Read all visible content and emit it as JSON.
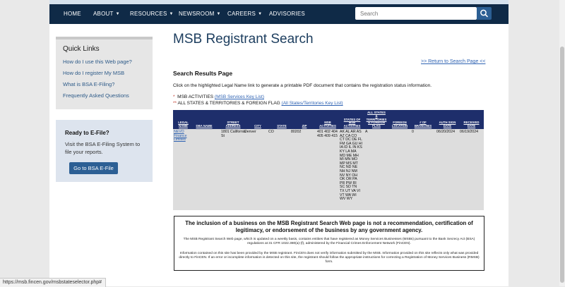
{
  "nav": {
    "items": [
      {
        "label": "HOME",
        "dropdown": false
      },
      {
        "label": "ABOUT",
        "dropdown": true
      },
      {
        "label": "RESOURCES",
        "dropdown": true
      },
      {
        "label": "NEWSROOM",
        "dropdown": true
      },
      {
        "label": "CAREERS",
        "dropdown": true
      },
      {
        "label": "ADVISORIES",
        "dropdown": false
      }
    ],
    "search_placeholder": "Search"
  },
  "sidebar": {
    "quick_links_title": "Quick Links",
    "links": [
      "How do I use this Web page?",
      "How do I register My MSB",
      "What is BSA E-Filing?",
      "Frequently Asked Questions"
    ],
    "efile_title": "Ready to E-File?",
    "efile_text": "Visit the BSA E-Filing System to file your reports.",
    "efile_button": "Go to BSA E-File"
  },
  "main": {
    "title": "MSB Registrant Search",
    "return_link": ">> Return to Search Page <<",
    "results_heading": "Search Results Page",
    "instruction": "Click on the highlighted Legal Name link to generate a printable PDF document that contains the registration status information.",
    "legend1_star": "*",
    "legend1_text": "MSB ACTIVITIES",
    "legend1_link": "(MSB Services Key List)",
    "legend2_star": "**",
    "legend2_text": "ALL STATES & TERRITORIES & FOREIGN FLAG",
    "legend2_link": "(All States/Territories Key List)"
  },
  "table": {
    "headers": [
      "LEGAL NAME",
      "DBA NAME",
      "STREET ADDRESS",
      "CITY",
      "STATE",
      "ZIP",
      "MSB ACTIVITIES",
      "STATES OF MSB ACTIVITIES",
      "ALL STATES & TERRITORIES & FOREIGN FLAG",
      "FOREIGN LOCATION",
      "# OF BRANCHES",
      "AUTH SIGN DATE",
      "RECEIVED DATE"
    ],
    "row": {
      "legal_name": "NEVO Finance Limited",
      "dba_name": "",
      "street": "1801 California St",
      "city": "Denver",
      "state": "CO",
      "zip": "80202",
      "activities": "401 402 404 405 409 415",
      "states": "AK AL AR AS AZ CA CO CT DC DE FL FM GA GU HI IA ID IL IN KS KY LA MA MD ME MH MI MN MO MP MS MT NC ND NE NH NJ NM NV NY OH OK OR PA PR PW RI SC SD TN TX UT VA VI VT WA WI WV WY",
      "all_states": "A",
      "foreign_location": "",
      "branches": "0",
      "auth_date": "06/20/2024",
      "received_date": "06/19/2024"
    }
  },
  "disclaimer": {
    "title": "The inclusion of a business on the MSB Registrant Search Web page is not a recommendation, certification of legitimacy, or endorsement of the business by any government agency.",
    "para1": "The MSB Registrant Search Web page, which is updated on a weekly basis, contains entities that have registered as Money Services Businesses (MSBs) pursuant to the Bank Secrecy Act (BSA) regulations at 31 CFR 1022.380(a)-(f), administered by the Financial Crimes Enforcement Network (FinCEN).",
    "para2": "Information contained on this site has been provided by the MSB registrant. FinCEN does not verify information submitted by the MSB. Information provided on this site reflects only what was provided directly to FinCEN. If an error or incomplete information is detected on this site, the registrant should follow the appropriate instructions for correcting a Registration of Money Services Business (RMSB) form."
  },
  "status_bar": {
    "url": "https://msb.fincen.gov/msbstateselector.php#"
  }
}
